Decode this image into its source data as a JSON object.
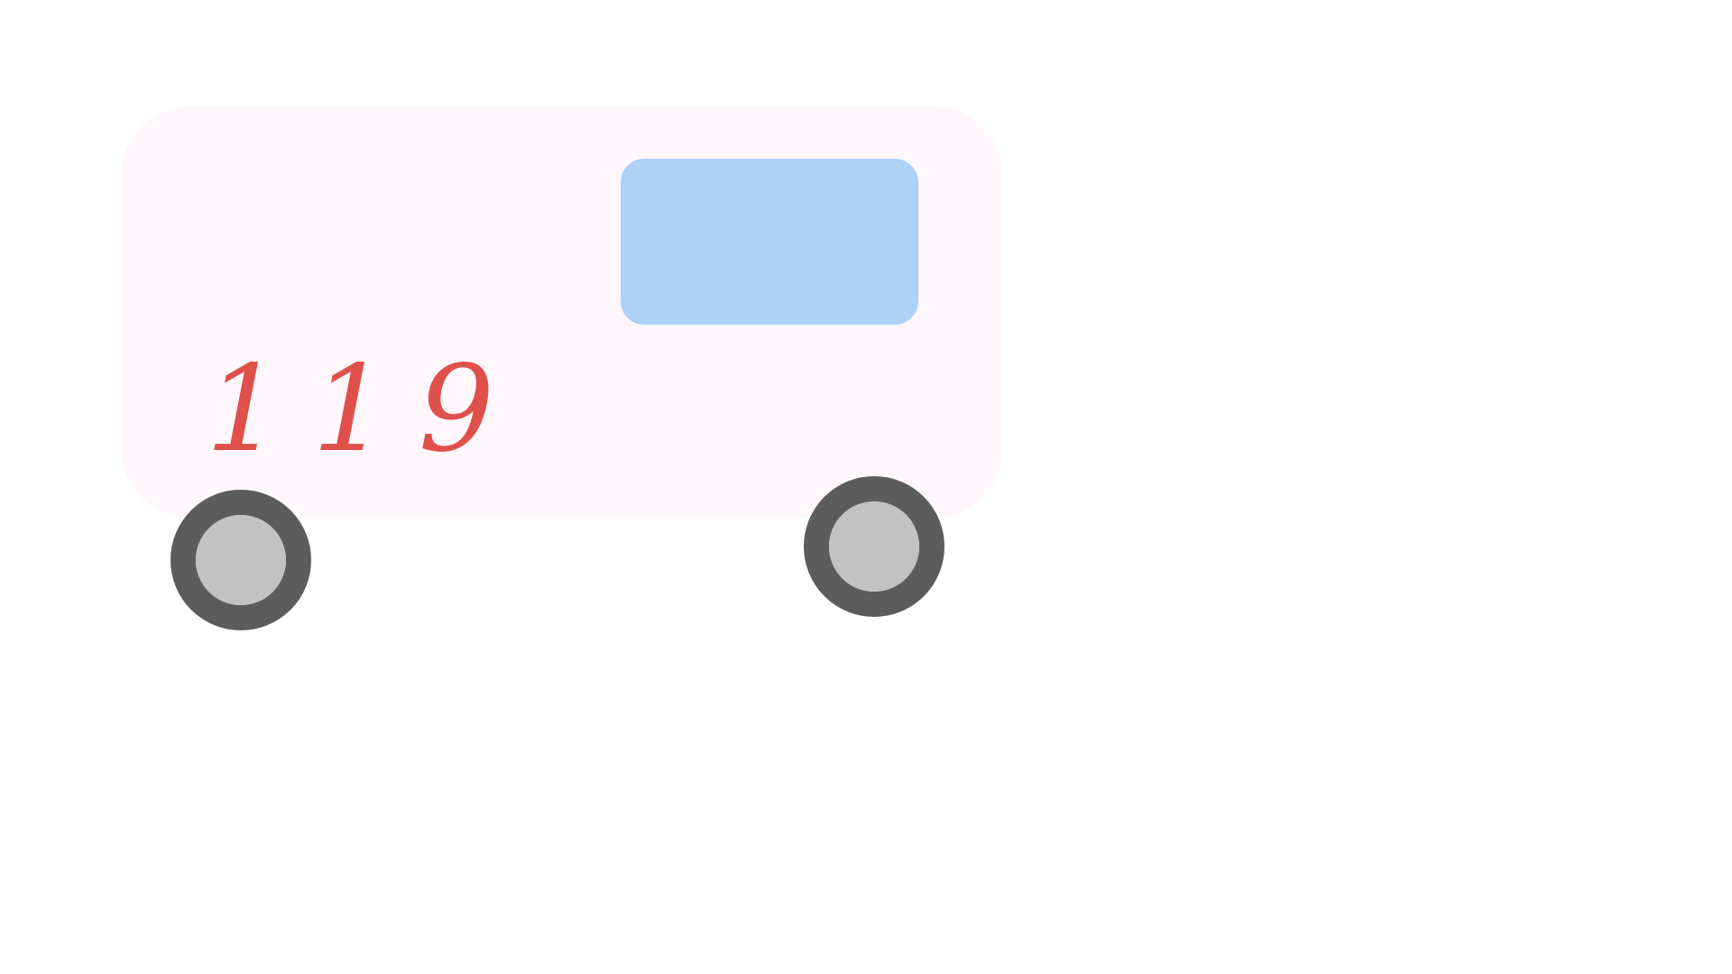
{
  "vehicle": {
    "number_label": "119",
    "colors": {
      "body": "#fff7fb",
      "window": "#add1f7",
      "number": "#e0504b",
      "tire": "#5c5c5c",
      "hub": "#c2c2c2"
    }
  }
}
